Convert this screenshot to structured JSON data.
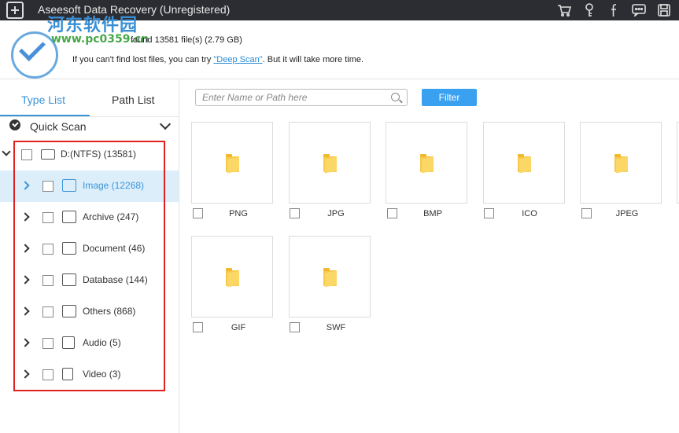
{
  "window": {
    "title": "Aseesoft Data Recovery (Unregistered)"
  },
  "watermark": {
    "text": "河东软件园",
    "url": "www.pc0359.cn"
  },
  "header": {
    "scan_info": "found 13581 file(s) (2.79 GB)",
    "tip_prefix": "If you can't find lost files, you can try ",
    "tip_link": "\"Deep Scan\"",
    "tip_suffix": ". But it will take more time."
  },
  "toolbar_icons": [
    "cart-icon",
    "key-icon",
    "facebook-icon",
    "feedback-icon",
    "save-icon"
  ],
  "sidebar": {
    "tabs": [
      {
        "label": "Type List",
        "active": true
      },
      {
        "label": "Path List",
        "active": false
      }
    ],
    "scan_mode": "Quick Scan",
    "drive": {
      "label": "D:(NTFS) (13581)",
      "icon": "drive-icon"
    },
    "items": [
      {
        "label": "Image (12268)",
        "icon": "image-icon",
        "selected": true
      },
      {
        "label": "Archive (247)",
        "icon": "archive-icon",
        "selected": false
      },
      {
        "label": "Document (46)",
        "icon": "document-icon",
        "selected": false
      },
      {
        "label": "Database (144)",
        "icon": "database-icon",
        "selected": false
      },
      {
        "label": "Others (868)",
        "icon": "folder-icon",
        "selected": false
      },
      {
        "label": "Audio (5)",
        "icon": "audio-icon",
        "selected": false
      },
      {
        "label": "Video (3)",
        "icon": "video-icon",
        "selected": false
      }
    ]
  },
  "search": {
    "placeholder": "Enter Name or Path here"
  },
  "filter_label": "Filter",
  "folders": [
    "PNG",
    "JPG",
    "BMP",
    "ICO",
    "JPEG",
    "GIF",
    "SWF"
  ],
  "colors": {
    "accent": "#3a95d8",
    "titlebar": "#2b2d33",
    "selected_row": "#ddeefb",
    "highlight_box": "#e02020",
    "folder": "#f7c94a"
  }
}
